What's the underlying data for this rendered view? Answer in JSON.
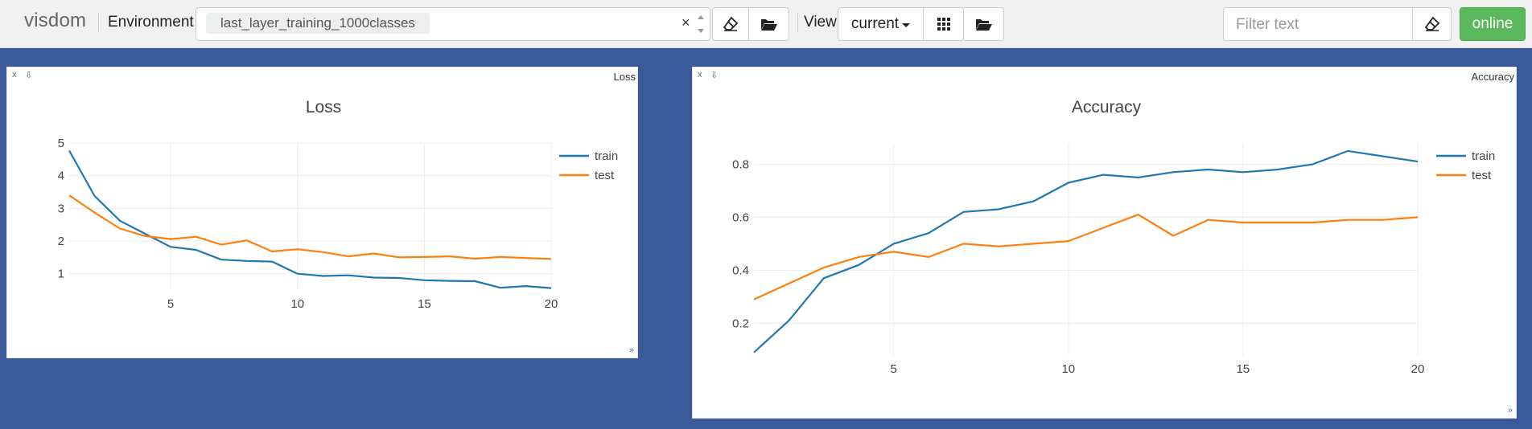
{
  "toolbar": {
    "brand": "visdom",
    "env_label": "Environment",
    "env_value": "last_layer_training_1000classes",
    "env_clear": "×",
    "view_label": "View",
    "view_value": "current",
    "filter_placeholder": "Filter text",
    "online_label": "online",
    "icons": [
      "eraser-icon",
      "folder-open-icon",
      "grid-icon",
      "folder-open-icon",
      "eraser-icon"
    ]
  },
  "panes": [
    {
      "label": "Loss",
      "close": "x",
      "pin": "⇩",
      "resize": "»",
      "chart_data": {
        "type": "line",
        "title": "Loss",
        "xlabel": "",
        "ylabel": "",
        "xlim": [
          1,
          20
        ],
        "ylim": [
          0.5,
          5
        ],
        "xticks": [
          5,
          10,
          15,
          20
        ],
        "yticks": [
          1,
          2,
          3,
          4,
          5
        ],
        "grid": true,
        "legend_position": "top-right",
        "x": [
          1,
          2,
          3,
          4,
          5,
          6,
          7,
          8,
          9,
          10,
          11,
          12,
          13,
          14,
          15,
          16,
          17,
          18,
          19,
          20
        ],
        "series": [
          {
            "name": "train",
            "color": "#1f77b4",
            "values": [
              4.77,
              3.38,
              2.62,
              2.22,
              1.82,
              1.73,
              1.43,
              1.39,
              1.37,
              1.0,
              0.93,
              0.95,
              0.88,
              0.87,
              0.8,
              0.78,
              0.77,
              0.57,
              0.62,
              0.56
            ]
          },
          {
            "name": "test",
            "color": "#ff7f0e",
            "values": [
              3.4,
              2.87,
              2.38,
              2.15,
              2.06,
              2.13,
              1.89,
              2.02,
              1.68,
              1.75,
              1.66,
              1.53,
              1.62,
              1.5,
              1.51,
              1.53,
              1.46,
              1.51,
              1.48,
              1.45
            ]
          }
        ]
      }
    },
    {
      "label": "Accuracy",
      "close": "x",
      "pin": "⇩",
      "resize": "»",
      "chart_data": {
        "type": "line",
        "title": "Accuracy",
        "xlabel": "",
        "ylabel": "",
        "xlim": [
          1,
          20
        ],
        "ylim": [
          0.08,
          0.88
        ],
        "xticks": [
          5,
          10,
          15,
          20
        ],
        "yticks": [
          0.2,
          0.4,
          0.6,
          0.8
        ],
        "grid": true,
        "legend_position": "top-right",
        "x": [
          1,
          2,
          3,
          4,
          5,
          6,
          7,
          8,
          9,
          10,
          11,
          12,
          13,
          14,
          15,
          16,
          17,
          18,
          19,
          20
        ],
        "series": [
          {
            "name": "train",
            "color": "#1f77b4",
            "values": [
              0.09,
              0.21,
              0.37,
              0.42,
              0.5,
              0.54,
              0.62,
              0.63,
              0.66,
              0.73,
              0.76,
              0.75,
              0.77,
              0.78,
              0.77,
              0.78,
              0.8,
              0.85,
              0.83,
              0.81
            ]
          },
          {
            "name": "test",
            "color": "#ff7f0e",
            "values": [
              0.29,
              0.35,
              0.41,
              0.45,
              0.47,
              0.45,
              0.5,
              0.49,
              0.5,
              0.51,
              0.56,
              0.61,
              0.53,
              0.59,
              0.58,
              0.58,
              0.58,
              0.59,
              0.59,
              0.6
            ]
          }
        ]
      }
    }
  ]
}
